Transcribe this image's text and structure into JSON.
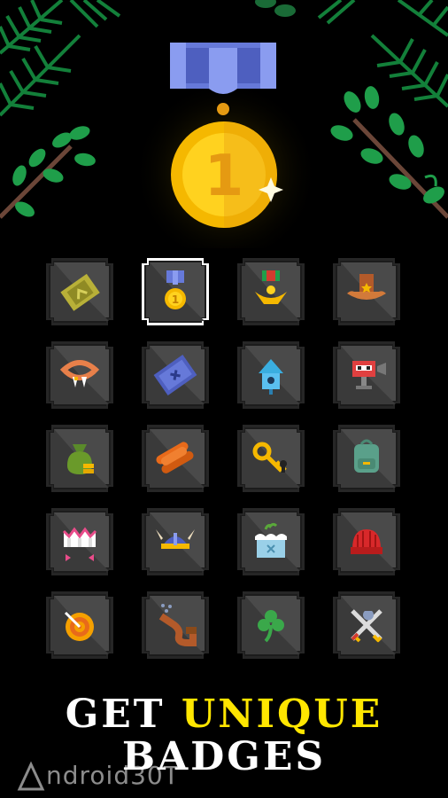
{
  "headline": {
    "line1_part1": "GET",
    "line1_part2": "UNIQUE",
    "line2": "BADGES"
  },
  "medal": {
    "number": "1"
  },
  "watermark": {
    "text": "ndroid30T"
  },
  "badges": [
    {
      "icon": "ticket-icon"
    },
    {
      "icon": "medal-icon",
      "selected": true
    },
    {
      "icon": "eagle-medal-icon"
    },
    {
      "icon": "cowboy-hat-icon"
    },
    {
      "icon": "fangs-icon"
    },
    {
      "icon": "map-icon"
    },
    {
      "icon": "birdhouse-icon"
    },
    {
      "icon": "robot-icon"
    },
    {
      "icon": "money-bag-icon"
    },
    {
      "icon": "logs-icon"
    },
    {
      "icon": "key-icon"
    },
    {
      "icon": "backpack-icon"
    },
    {
      "icon": "crown-icon"
    },
    {
      "icon": "viking-helmet-icon"
    },
    {
      "icon": "cake-icon"
    },
    {
      "icon": "beanie-icon"
    },
    {
      "icon": "target-icon"
    },
    {
      "icon": "pipe-icon"
    },
    {
      "icon": "clover-icon"
    },
    {
      "icon": "crossed-swords-icon"
    }
  ],
  "colors": {
    "tile": "#4a4a4a",
    "tile_dark": "#2e2e2e",
    "accent_yellow": "#ffe600",
    "gold": "#f5b800",
    "leaf": "#1f9e4a"
  }
}
